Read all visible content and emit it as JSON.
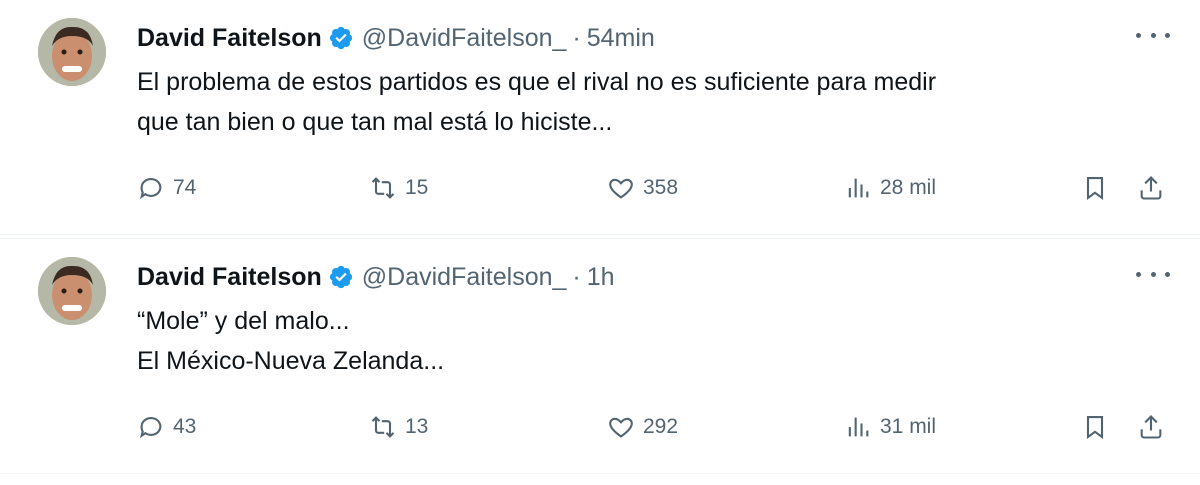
{
  "tweets": [
    {
      "author_name": "David Faitelson",
      "handle": "@DavidFaitelson_",
      "separator": "·",
      "time": "54min",
      "text_lines": [
        "El problema de estos partidos es que el rival no es suficiente para medir",
        "que tan bien o que tan mal está lo hiciste..."
      ],
      "replies": "74",
      "retweets": "15",
      "likes": "358",
      "views": "28 mil"
    },
    {
      "author_name": "David Faitelson",
      "handle": "@DavidFaitelson_",
      "separator": "·",
      "time": "1h",
      "text_lines": [
        "“Mole” y del malo...",
        "El México-Nueva Zelanda..."
      ],
      "replies": "43",
      "retweets": "13",
      "likes": "292",
      "views": "31 mil"
    }
  ],
  "colors": {
    "text": "#0f1419",
    "secondary": "#536471",
    "verified": "#1d9bf0",
    "divider": "#eff3f4"
  },
  "icons": [
    "avatar",
    "verified-badge-icon",
    "more-icon",
    "reply-icon",
    "retweet-icon",
    "like-icon",
    "views-icon",
    "bookmark-icon",
    "share-icon"
  ]
}
